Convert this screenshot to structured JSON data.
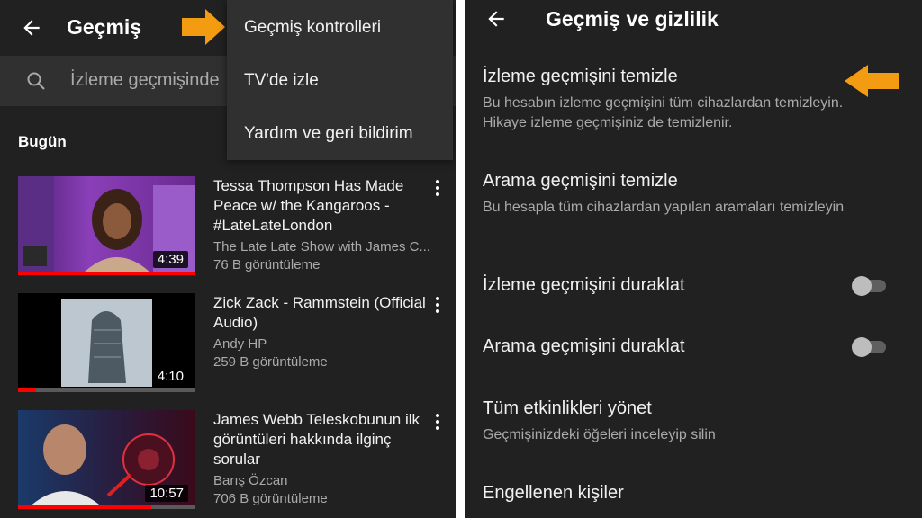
{
  "history_screen": {
    "title": "Geçmiş",
    "search_placeholder": "İzleme geçmişinde",
    "section_today": "Bugün",
    "menu": {
      "items": [
        {
          "label": "Geçmiş kontrolleri"
        },
        {
          "label": "TV'de izle"
        },
        {
          "label": "Yardım ve geri bildirim"
        }
      ]
    },
    "videos": [
      {
        "title": "Tessa Thompson Has Made Peace w/ the Kangaroos - #LateLateLondon",
        "channel": "The Late Late Show with James C...",
        "views": "76 B görüntüleme",
        "duration": "4:39",
        "progress": 1.0
      },
      {
        "title": "Zick Zack - Rammstein (Official Audio)",
        "channel": "Andy HP",
        "views": "259 B görüntüleme",
        "duration": "4:10",
        "progress": 0.1
      },
      {
        "title": "James Webb Teleskobunun ilk görüntüleri hakkında ilginç sorular",
        "channel": "Barış Özcan",
        "views": "706 B görüntüleme",
        "duration": "10:57",
        "progress": 0.75
      }
    ]
  },
  "privacy_screen": {
    "title": "Geçmiş ve gizlilik",
    "settings": [
      {
        "title": "İzleme geçmişini temizle",
        "description": "Bu hesabın izleme geçmişini tüm cihazlardan temizleyin. Hikaye izleme geçmişiniz de temizlenir."
      },
      {
        "title": "Arama geçmişini temizle",
        "description": "Bu hesapla tüm cihazlardan yapılan aramaları temizleyin"
      },
      {
        "title": "İzleme geçmişini duraklat",
        "toggle": false
      },
      {
        "title": "Arama geçmişini duraklat",
        "toggle": false
      },
      {
        "title": "Tüm etkinlikleri yönet",
        "description": "Geçmişinizdeki öğeleri inceleyip silin"
      },
      {
        "title": "Engellenen kişiler"
      }
    ]
  },
  "colors": {
    "background": "#212121",
    "accent_arrow": "#f39c12",
    "progress": "#ff0000",
    "secondary_text": "#aaaaaa"
  }
}
